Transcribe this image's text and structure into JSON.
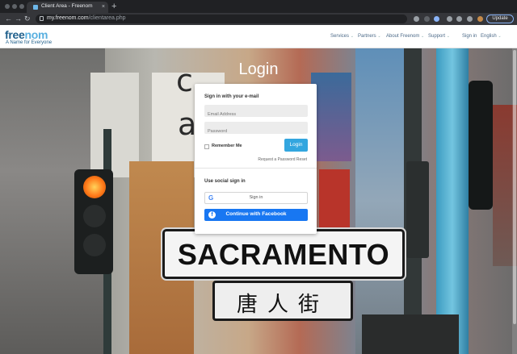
{
  "browser": {
    "tab_title": "Client Area - Freenom",
    "tab_close": "×",
    "new_tab": "+",
    "url_host": "my.freenom.com",
    "url_path": "/clientarea.php",
    "update_label": "Update",
    "back": "←",
    "forward": "→",
    "reload": "↻"
  },
  "site": {
    "logo_text_a": "free",
    "logo_text_b": "nom",
    "tagline": "A Name for Everyone",
    "nav": [
      {
        "label": "Services",
        "caret": "⌄"
      },
      {
        "label": "Partners",
        "caret": "⌄"
      },
      {
        "label": "About Freenom",
        "caret": "⌄"
      },
      {
        "label": "Support",
        "caret": "⌄"
      },
      {
        "label": "Sign in",
        "caret": ""
      },
      {
        "label": "English",
        "caret": "⌄"
      }
    ]
  },
  "login": {
    "title": "Login",
    "email_section": "Sign in with your e-mail",
    "email_placeholder": "Email Address",
    "password_placeholder": "Password",
    "remember_label": "Remember Me",
    "login_button": "Login",
    "reset_link": "Request a Password Reset",
    "social_section": "Use social sign in",
    "google_icon": "G",
    "google_label": "Sign in",
    "facebook_icon": "f",
    "facebook_label": "Continue with Facebook"
  },
  "scene": {
    "sign_main": "SACRAMENTO",
    "sign_chinese": "唐人街",
    "storefront_letters": [
      "c",
      "a"
    ]
  }
}
